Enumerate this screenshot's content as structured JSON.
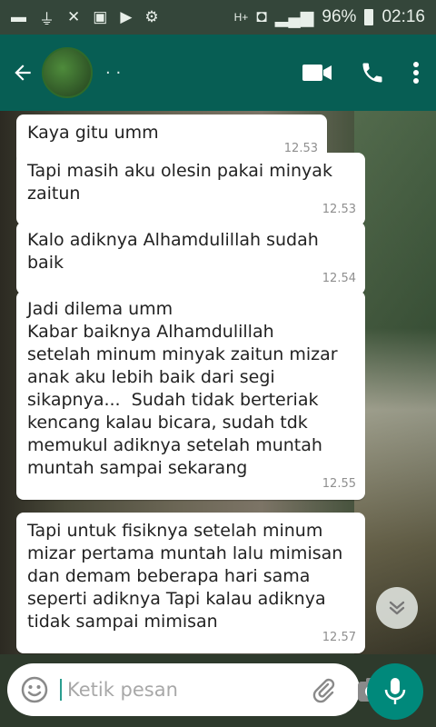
{
  "status_bar": {
    "network": "H+",
    "battery": "96%",
    "time": "02:16"
  },
  "header": {
    "contact_name": "· ·"
  },
  "messages": [
    {
      "text": "Kaya gitu umm",
      "time": "12.53"
    },
    {
      "text": "Tapi masih aku olesin pakai minyak\nzaitun",
      "time": "12.53"
    },
    {
      "text": "Kalo adiknya Alhamdulillah sudah\nbaik",
      "time": "12.54"
    },
    {
      "text": "Jadi dilema umm\nKabar baiknya Alhamdulillah\nsetelah minum minyak zaitun mizar\nanak aku lebih baik dari segi\nsikapnya...  Sudah tidak berteriak\nkencang kalau bicara, sudah tdk\nmemukul adiknya setelah muntah\nmuntah sampai sekarang",
      "time": "12.55"
    },
    {
      "text": "Tapi untuk fisiknya setelah minum\nmizar pertama muntah lalu mimisan\ndan demam beberapa hari sama\nseperti adiknya Tapi kalau adiknya\ntidak sampai mimisan",
      "time": "12.57"
    }
  ],
  "composer": {
    "placeholder": "Ketik pesan"
  },
  "icons": {
    "back": "arrow-left-icon",
    "video": "video-call-icon",
    "call": "phone-icon",
    "menu": "more-vert-icon",
    "emoji": "emoji-icon",
    "attach": "paperclip-icon",
    "camera": "camera-icon",
    "mic": "mic-icon",
    "scroll": "chevron-double-down-icon"
  },
  "colors": {
    "header": "#075e54",
    "mic_button": "#00897b",
    "bubble": "#ffffff"
  }
}
